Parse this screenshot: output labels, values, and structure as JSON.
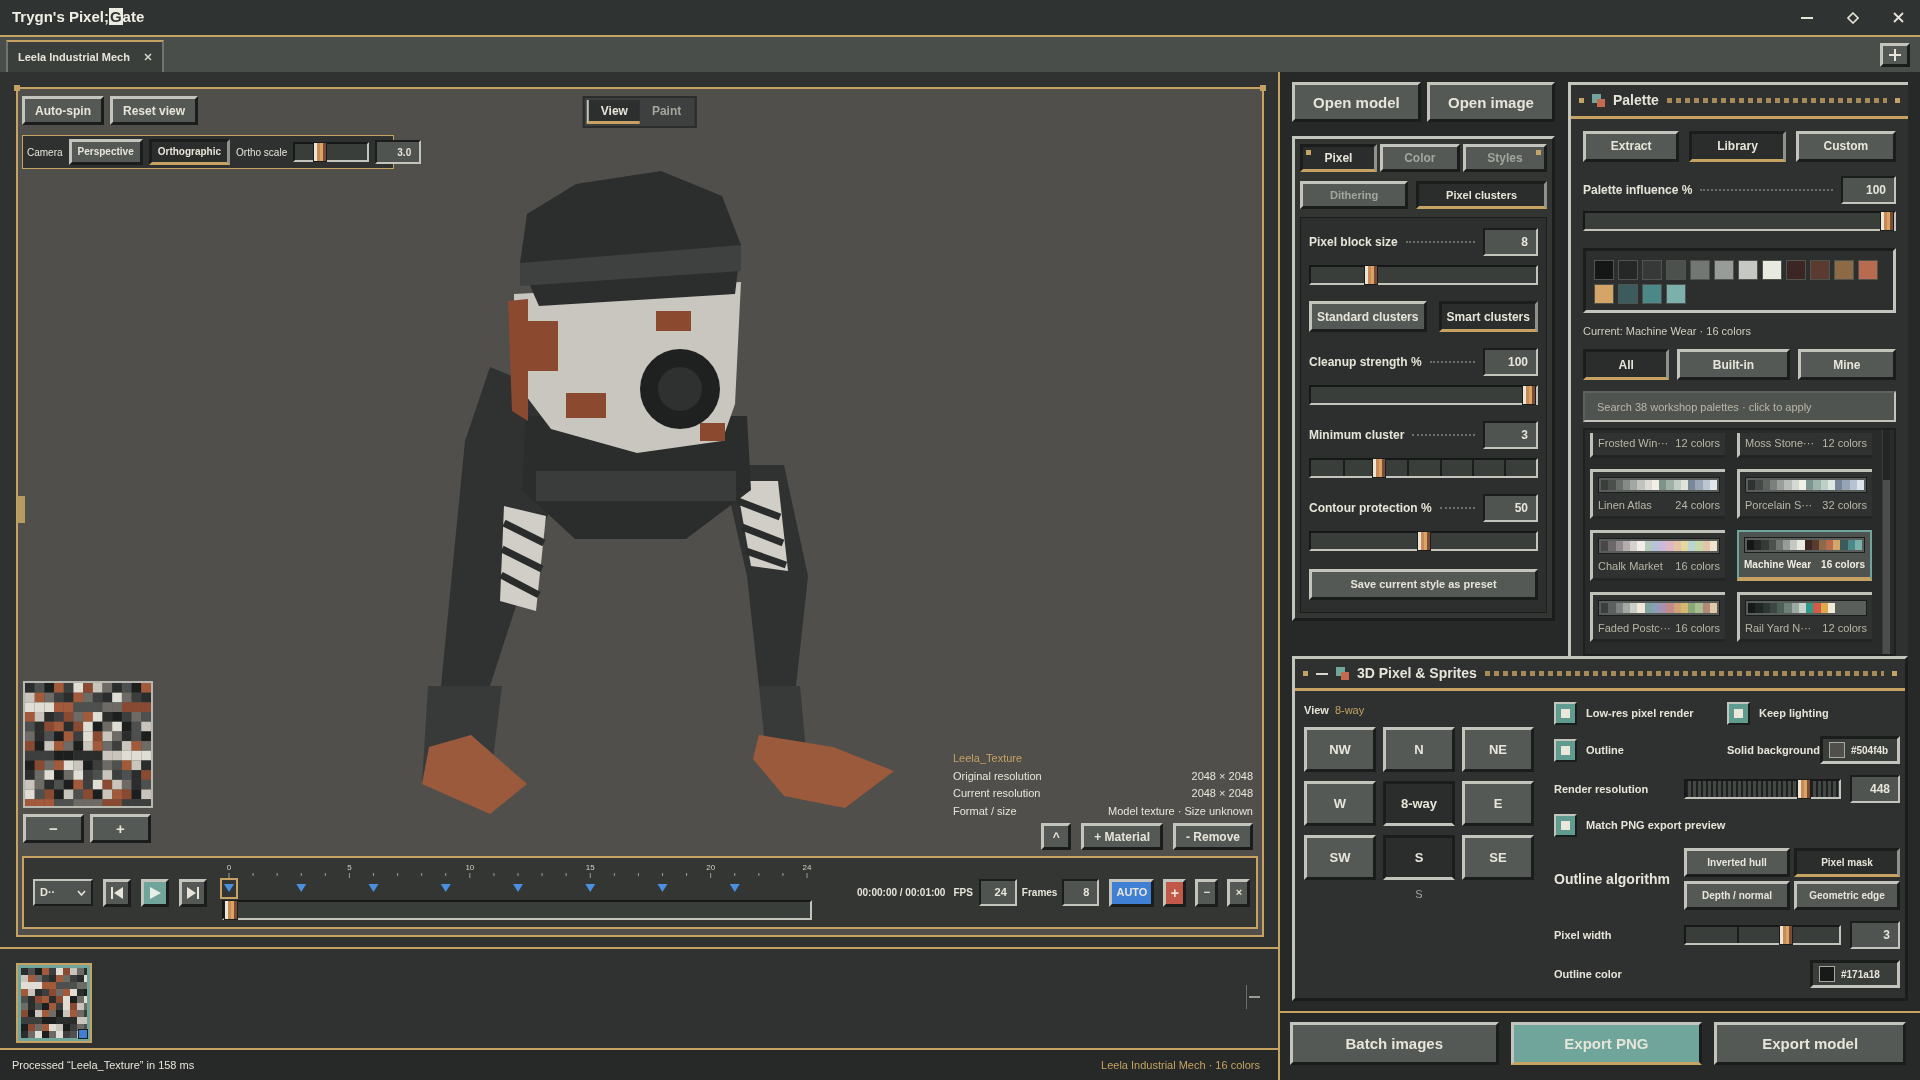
{
  "window": {
    "title": [
      {
        "text": "Trygn's Pixel;",
        "highlighted": false
      },
      {
        "text": "G",
        "highlighted": true
      },
      {
        "text": "ate",
        "highlighted": false
      }
    ]
  },
  "tabs": [
    {
      "label": "Leela Industrial Mech",
      "selected": true
    }
  ],
  "viewport": {
    "buttons": [
      "Auto-spin",
      "Reset view"
    ],
    "modes": [
      {
        "label": "View",
        "selected": true
      },
      {
        "label": "Paint",
        "selected": false
      }
    ],
    "camera": {
      "label": "Camera",
      "projections": [
        {
          "label": "Perspective",
          "selected": false
        },
        {
          "label": "Orthographic",
          "selected": true
        }
      ],
      "scale_label": "Ortho scale",
      "level": 0.3,
      "value": "3.0"
    },
    "texture_zoom": [
      "−",
      "+"
    ],
    "texture": {
      "name": "Leela_Texture",
      "rows": [
        {
          "label": "Original resolution",
          "value": "2048 × 2048"
        },
        {
          "label": "Current resolution",
          "value": "2048 × 2048"
        },
        {
          "label": "Format / size",
          "value": "Model texture · Size unknown"
        }
      ],
      "buttons": [
        "^",
        "+ Material",
        "- Remove"
      ]
    },
    "timeline": {
      "mode": "D··",
      "playing": true,
      "ruler": [
        "0",
        "5",
        "10",
        "15",
        "20",
        "24"
      ],
      "keyframes": [
        {
          "selected": true
        },
        {
          "selected": false
        },
        {
          "selected": false
        },
        {
          "selected": false
        },
        {
          "selected": false
        },
        {
          "selected": false
        },
        {
          "selected": false
        },
        {
          "selected": false
        }
      ],
      "level": 0,
      "time": "00:00:00 / 00:01:00",
      "fps_label": "FPS",
      "fps": "24",
      "frames_label": "Frames",
      "frames": "8",
      "buttons": [
        {
          "kind": "auto",
          "label": "AUTO"
        },
        {
          "kind": "add",
          "label": "+"
        },
        {
          "kind": "remove",
          "label": "−"
        },
        {
          "kind": "close",
          "label": "×"
        }
      ]
    }
  },
  "thumbnails": [
    {
      "selected": true
    }
  ],
  "status_bar": {
    "message": "Processed “Leela_Texture” in 158 ms",
    "summary": "Leela Industrial Mech · 16 colors"
  },
  "file_actions": [
    "Open model",
    "Open image"
  ],
  "style_panel": {
    "tabs": [
      {
        "label": "Pixel",
        "selected": true
      },
      {
        "label": "Color",
        "selected": false
      },
      {
        "label": "Styles",
        "selected": false
      }
    ],
    "subtabs": [
      {
        "label": "Dithering",
        "selected": false
      },
      {
        "label": "Pixel clusters",
        "selected": true
      }
    ],
    "controls": [
      {
        "kind": "slider",
        "label": "Pixel block size",
        "value": "8",
        "level": 0.25
      },
      {
        "kind": "choice",
        "options": [
          {
            "label": "Standard clusters",
            "selected": false
          },
          {
            "label": "Smart clusters",
            "selected": true
          }
        ]
      },
      {
        "kind": "slider",
        "label": "Cleanup strength %",
        "value": "100",
        "level": 1
      },
      {
        "kind": "stepped",
        "label": "Minimum cluster",
        "value": "3",
        "level": 0.29
      },
      {
        "kind": "slider",
        "label": "Contour protection %",
        "value": "50",
        "level": 0.5
      }
    ],
    "preset": "Save current style as preset"
  },
  "palette": {
    "title": "Palette",
    "tabs": [
      {
        "label": "Extract",
        "selected": false
      },
      {
        "label": "Library",
        "selected": true
      },
      {
        "label": "Custom",
        "selected": false
      }
    ],
    "influence": {
      "label": "Palette influence %",
      "value": "100",
      "level": 1
    },
    "swatches": [
      {
        "color": "#151716"
      },
      {
        "color": "#252826"
      },
      {
        "color": "#363937"
      },
      {
        "color": "#4d514e"
      },
      {
        "color": "#737774"
      },
      {
        "color": "#989c99"
      },
      {
        "color": "#c6c8c4"
      },
      {
        "color": "#e9eadf"
      },
      {
        "color": "#3b2624"
      },
      {
        "color": "#5b3b30"
      },
      {
        "color": "#8c6a46"
      },
      {
        "color": "#b96b50"
      },
      {
        "color": "#d4a566"
      },
      {
        "color": "#3c5b5d"
      },
      {
        "color": "#4d8889"
      },
      {
        "color": "#7bb0ab"
      }
    ],
    "current": "Current: Machine Wear · 16 colors",
    "filters": [
      {
        "label": "All",
        "selected": true
      },
      {
        "label": "Built-in",
        "selected": false
      },
      {
        "label": "Mine",
        "selected": false
      }
    ],
    "search": {
      "placeholder": "Search 38 workshop palettes · click to apply"
    },
    "library": [
      {
        "name": "Frosted Win···",
        "count": "12 colors",
        "selected": false
      },
      {
        "name": "Moss Stone···",
        "count": "12 colors",
        "selected": false
      },
      {
        "name": "Linen Atlas",
        "count": "24 colors",
        "selected": false,
        "swatches": [
          {
            "color": "#3a3d3b"
          },
          {
            "color": "#4c504d"
          },
          {
            "color": "#6a6e6b"
          },
          {
            "color": "#878b88"
          },
          {
            "color": "#a3a7a4"
          },
          {
            "color": "#c0c3bf"
          },
          {
            "color": "#dcdcd4"
          },
          {
            "color": "#f2f0e6"
          },
          {
            "color": "#7f9488"
          },
          {
            "color": "#9fb1a6"
          },
          {
            "color": "#c2cdc4"
          },
          {
            "color": "#dfe3da"
          },
          {
            "color": "#7a879b"
          },
          {
            "color": "#9aa6b6"
          },
          {
            "color": "#bcc6d0"
          },
          {
            "color": "#dfe6ec"
          }
        ]
      },
      {
        "name": "Porcelain S···",
        "count": "32 colors",
        "selected": false,
        "swatches": [
          {
            "color": "#2e3230"
          },
          {
            "color": "#454947"
          },
          {
            "color": "#5f6360"
          },
          {
            "color": "#7c807d"
          },
          {
            "color": "#9a9e9b"
          },
          {
            "color": "#b8bbb8"
          },
          {
            "color": "#d6d8d3"
          },
          {
            "color": "#f0efe8"
          },
          {
            "color": "#7c968f"
          },
          {
            "color": "#9db3ac"
          },
          {
            "color": "#bcd0c8"
          },
          {
            "color": "#dce7e2"
          },
          {
            "color": "#76849a"
          },
          {
            "color": "#97a4b6"
          },
          {
            "color": "#b8c3d1"
          },
          {
            "color": "#dbe3ec"
          }
        ]
      },
      {
        "name": "Chalk Market",
        "count": "16 colors",
        "selected": false,
        "swatches": [
          {
            "color": "#4a4748"
          },
          {
            "color": "#6c6869"
          },
          {
            "color": "#908b8c"
          },
          {
            "color": "#b4aeaf"
          },
          {
            "color": "#d6d0cf"
          },
          {
            "color": "#f2ede6"
          },
          {
            "color": "#b6cbbd"
          },
          {
            "color": "#b7c3d9"
          },
          {
            "color": "#cdb9d8"
          },
          {
            "color": "#e0b7c4"
          },
          {
            "color": "#e6c3a4"
          },
          {
            "color": "#e6d79e"
          },
          {
            "color": "#b9d6d4"
          },
          {
            "color": "#c9d9a8"
          },
          {
            "color": "#e4c4a8"
          },
          {
            "color": "#f0e4d0"
          }
        ]
      },
      {
        "name": "Machine Wear",
        "count": "16 colors",
        "selected": true,
        "swatches": [
          {
            "color": "#151716"
          },
          {
            "color": "#252826"
          },
          {
            "color": "#363937"
          },
          {
            "color": "#4d514e"
          },
          {
            "color": "#737774"
          },
          {
            "color": "#989c99"
          },
          {
            "color": "#c6c8c4"
          },
          {
            "color": "#e9eadf"
          },
          {
            "color": "#3b2624"
          },
          {
            "color": "#5b3b30"
          },
          {
            "color": "#8c6a46"
          },
          {
            "color": "#b96b50"
          },
          {
            "color": "#d4a566"
          },
          {
            "color": "#3c5b5d"
          },
          {
            "color": "#4d8889"
          },
          {
            "color": "#7bb0ab"
          }
        ]
      },
      {
        "name": "Faded Postc···",
        "count": "16 colors",
        "selected": false,
        "swatches": [
          {
            "color": "#3c3f3e"
          },
          {
            "color": "#5c605e"
          },
          {
            "color": "#7e8280"
          },
          {
            "color": "#a5a9a5"
          },
          {
            "color": "#cbcdc6"
          },
          {
            "color": "#efe8d8"
          },
          {
            "color": "#7fa3a0"
          },
          {
            "color": "#8aa0b8"
          },
          {
            "color": "#a890b0"
          },
          {
            "color": "#c08a86"
          },
          {
            "color": "#d4a07a"
          },
          {
            "color": "#d8b870"
          },
          {
            "color": "#8aa878"
          },
          {
            "color": "#a8c090"
          },
          {
            "color": "#b08878"
          },
          {
            "color": "#e0c8a8"
          }
        ]
      },
      {
        "name": "Rail Yard N···",
        "count": "12 colors",
        "selected": false,
        "swatches": [
          {
            "color": "#151918"
          },
          {
            "color": "#1f2725"
          },
          {
            "color": "#2b3532"
          },
          {
            "color": "#3a4742"
          },
          {
            "color": "#4f5f59"
          },
          {
            "color": "#6f8079"
          },
          {
            "color": "#9aaaa2"
          },
          {
            "color": "#c8d2cc"
          },
          {
            "color": "#2e9a8c"
          },
          {
            "color": "#d05a48"
          },
          {
            "color": "#e0a848"
          },
          {
            "color": "#f0ead8"
          }
        ]
      }
    ]
  },
  "sprites": {
    "title": "3D Pixel & Sprites",
    "view_label": "View",
    "view_mode": "8-way",
    "directions": [
      {
        "label": "NW",
        "selected": false
      },
      {
        "label": "N",
        "selected": false
      },
      {
        "label": "NE",
        "selected": false
      },
      {
        "label": "W",
        "selected": false
      },
      {
        "label": "8-way",
        "selected": true
      },
      {
        "label": "E",
        "selected": false
      },
      {
        "label": "SW",
        "selected": false
      },
      {
        "label": "S",
        "selected": true
      },
      {
        "label": "SE",
        "selected": false
      }
    ],
    "direction_caption": "S",
    "rows": [
      [
        {
          "kind": "checkbox",
          "label": "Low-res pixel render",
          "checked": true
        },
        {
          "kind": "checkbox",
          "label": "Keep lighting",
          "checked": true
        }
      ],
      [
        {
          "kind": "checkbox",
          "label": "Outline",
          "checked": true
        },
        {
          "kind": "color",
          "label": "Solid background",
          "value": "#504f4b",
          "color": "#504f4b"
        }
      ],
      [
        {
          "kind": "ticked",
          "label": "Render resolution",
          "value": "448",
          "level": 0.8
        }
      ],
      [
        {
          "kind": "checkbox",
          "label": "Match PNG export preview",
          "checked": true
        }
      ],
      [
        {
          "kind": "choice",
          "label": "Outline algorithm",
          "options": [
            {
              "label": "Inverted hull",
              "selected": false
            },
            {
              "label": "Pixel mask",
              "selected": true
            },
            {
              "label": "Depth / normal",
              "selected": false
            },
            {
              "label": "Geometric edge",
              "selected": false
            }
          ]
        }
      ],
      [
        {
          "kind": "stepped",
          "label": "Pixel width",
          "value": "3",
          "level": 0.67
        }
      ],
      [
        {
          "kind": "color",
          "label": "Outline color",
          "value": "#171a18",
          "color": "#171a18"
        }
      ]
    ]
  },
  "export_actions": [
    {
      "label": "Batch images",
      "primary": false
    },
    {
      "label": "Export PNG",
      "primary": true
    },
    {
      "label": "Export model",
      "primary": false
    }
  ]
}
